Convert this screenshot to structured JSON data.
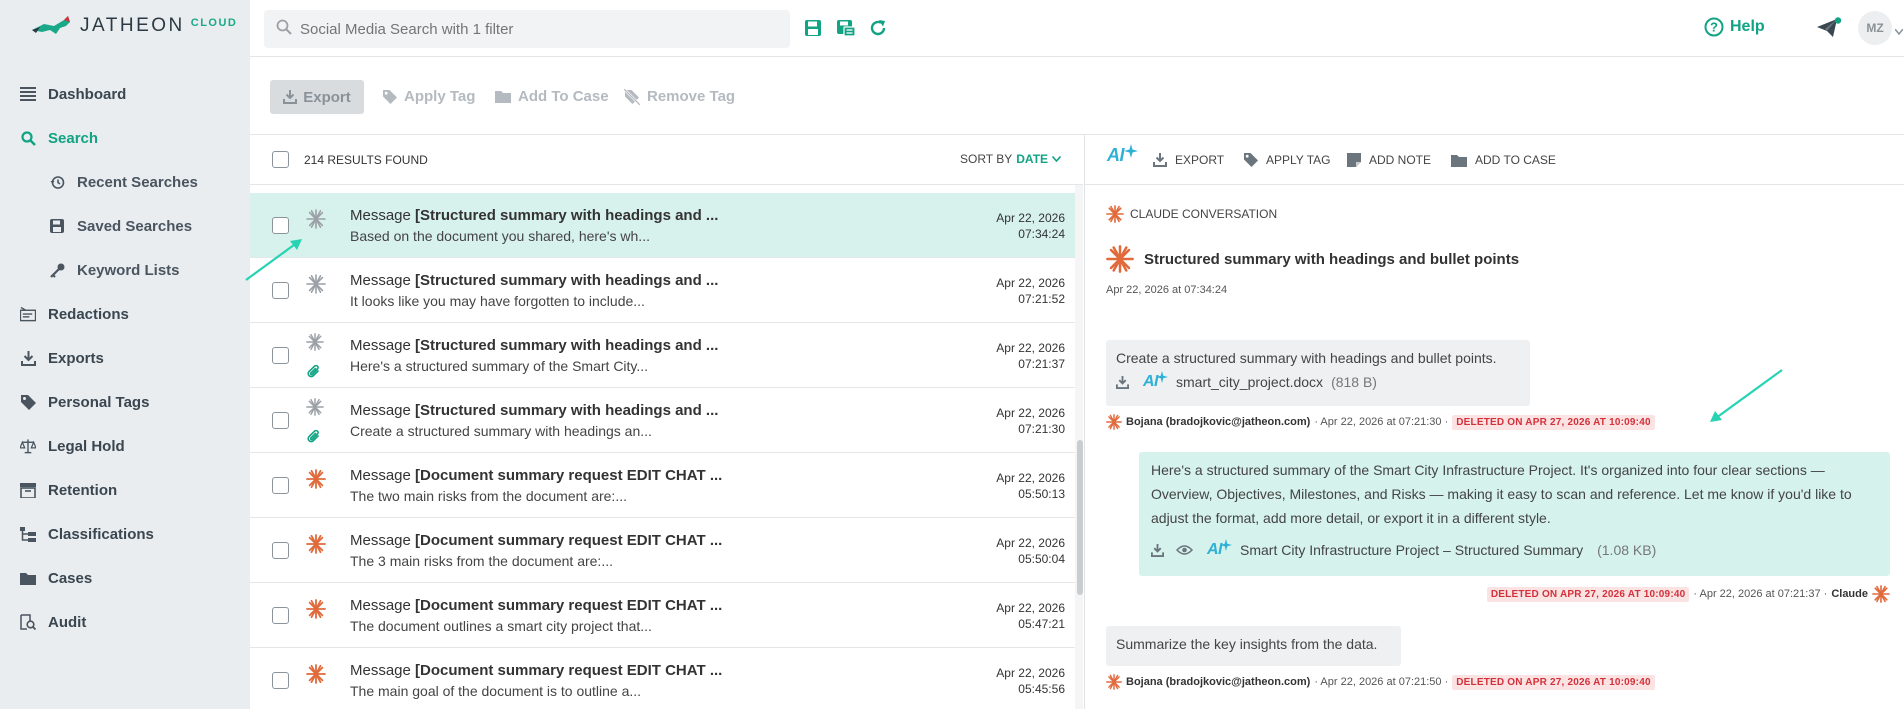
{
  "brand": {
    "name": "JATHEON",
    "suffix": "CLOUD"
  },
  "search": {
    "placeholder": "Social Media Search with 1 filter"
  },
  "header": {
    "help_label": "Help",
    "avatar": "MZ"
  },
  "sidebar": {
    "items": [
      {
        "label": "Dashboard",
        "icon": "dashboard-icon"
      },
      {
        "label": "Search",
        "icon": "search-icon",
        "active": true
      },
      {
        "label": "Recent Searches",
        "icon": "history-icon",
        "sub": true
      },
      {
        "label": "Saved Searches",
        "icon": "save-icon",
        "sub": true
      },
      {
        "label": "Keyword Lists",
        "icon": "key-icon",
        "sub": true
      },
      {
        "label": "Redactions",
        "icon": "redaction-icon"
      },
      {
        "label": "Exports",
        "icon": "export-icon"
      },
      {
        "label": "Personal Tags",
        "icon": "tag-icon"
      },
      {
        "label": "Legal Hold",
        "icon": "scale-icon"
      },
      {
        "label": "Retention",
        "icon": "retention-icon"
      },
      {
        "label": "Classifications",
        "icon": "classification-icon"
      },
      {
        "label": "Cases",
        "icon": "folder-icon"
      },
      {
        "label": "Audit",
        "icon": "audit-icon"
      }
    ]
  },
  "toolbar": {
    "export_label": "Export",
    "apply_tag_label": "Apply Tag",
    "add_to_case_label": "Add To Case",
    "remove_tag_label": "Remove Tag"
  },
  "list": {
    "results_label": "214 RESULTS FOUND",
    "sort_prefix": "SORT BY",
    "sort_field": "DATE",
    "rows": [
      {
        "type": "Message",
        "title": "[Structured summary with headings and ...",
        "snippet": "Based on the document you shared, here's wh...",
        "date": "Apr 22, 2026",
        "time": "07:34:24",
        "icon": "claude-gray",
        "attach": false,
        "selected": true
      },
      {
        "type": "Message",
        "title": "[Structured summary with headings and ...",
        "snippet": "It looks like you may have forgotten to include...",
        "date": "Apr 22, 2026",
        "time": "07:21:52",
        "icon": "claude-gray",
        "attach": false
      },
      {
        "type": "Message",
        "title": "[Structured summary with headings and ...",
        "snippet": "Here's a structured summary of the Smart City...",
        "date": "Apr 22, 2026",
        "time": "07:21:37",
        "icon": "claude-gray",
        "attach": true
      },
      {
        "type": "Message",
        "title": "[Structured summary with headings and ...",
        "snippet": "Create a structured summary with headings an...",
        "date": "Apr 22, 2026",
        "time": "07:21:30",
        "icon": "claude-gray",
        "attach": true
      },
      {
        "type": "Message",
        "title": "[Document summary request EDIT CHAT ...",
        "snippet": "The two main risks from the document are:...",
        "date": "Apr 22, 2026",
        "time": "05:50:13",
        "icon": "claude-orange",
        "attach": false
      },
      {
        "type": "Message",
        "title": "[Document summary request EDIT CHAT ...",
        "snippet": "The 3 main risks from the document are:...",
        "date": "Apr 22, 2026",
        "time": "05:50:04",
        "icon": "claude-orange",
        "attach": false
      },
      {
        "type": "Message",
        "title": "[Document summary request EDIT CHAT ...",
        "snippet": "The document outlines a smart city project that...",
        "date": "Apr 22, 2026",
        "time": "05:47:21",
        "icon": "claude-orange",
        "attach": false
      },
      {
        "type": "Message",
        "title": "[Document summary request EDIT CHAT ...",
        "snippet": "The main goal of the document is to outline a...",
        "date": "Apr 22, 2026",
        "time": "05:45:56",
        "icon": "claude-orange",
        "attach": false
      }
    ]
  },
  "detail": {
    "actions": {
      "ai": "AI",
      "export": "EXPORT",
      "apply_tag": "APPLY TAG",
      "add_note": "ADD NOTE",
      "add_to_case": "ADD TO CASE"
    },
    "conversation_type": "CLAUDE CONVERSATION",
    "title": "Structured summary with headings and bullet points",
    "date": "Apr 22, 2026 at 07:34:24",
    "messages": [
      {
        "text": "Create a structured summary with headings and bullet points.",
        "attachment": {
          "ai": "AI",
          "name": "smart_city_project.docx",
          "size": "(818 B)"
        },
        "author": "Bojana (bradojkovic@jatheon.com)",
        "time": "· Apr 22, 2026 at 07:21:30 ·",
        "deleted": "DELETED ON APR 27, 2026 AT 10:09:40"
      },
      {
        "text": "Here's a structured summary of the Smart City Infrastructure Project. It's organized into four clear sections — Overview, Objectives, Milestones, and Risks — making it easy to scan and reference. Let me know if you'd like to adjust the format, add more detail, or export it in a different style.",
        "attachment": {
          "ai": "AI",
          "name": "Smart City Infrastructure Project – Structured Summary",
          "size": "(1.08 KB)"
        },
        "author": "Claude",
        "time": "· Apr 22, 2026 at 07:21:37 ·",
        "deleted": "DELETED ON APR 27, 2026 AT 10:09:40"
      },
      {
        "text": "Summarize the key insights from the data.",
        "author": "Bojana (bradojkovic@jatheon.com)",
        "time": "· Apr 22, 2026 at 07:21:50 ·",
        "deleted": "DELETED ON APR 27, 2026 AT 10:09:40"
      }
    ]
  },
  "colors": {
    "accent": "#11a383",
    "claude": "#e06a3b",
    "deleted": "#d3313a",
    "selected": "#d7f1ec"
  }
}
